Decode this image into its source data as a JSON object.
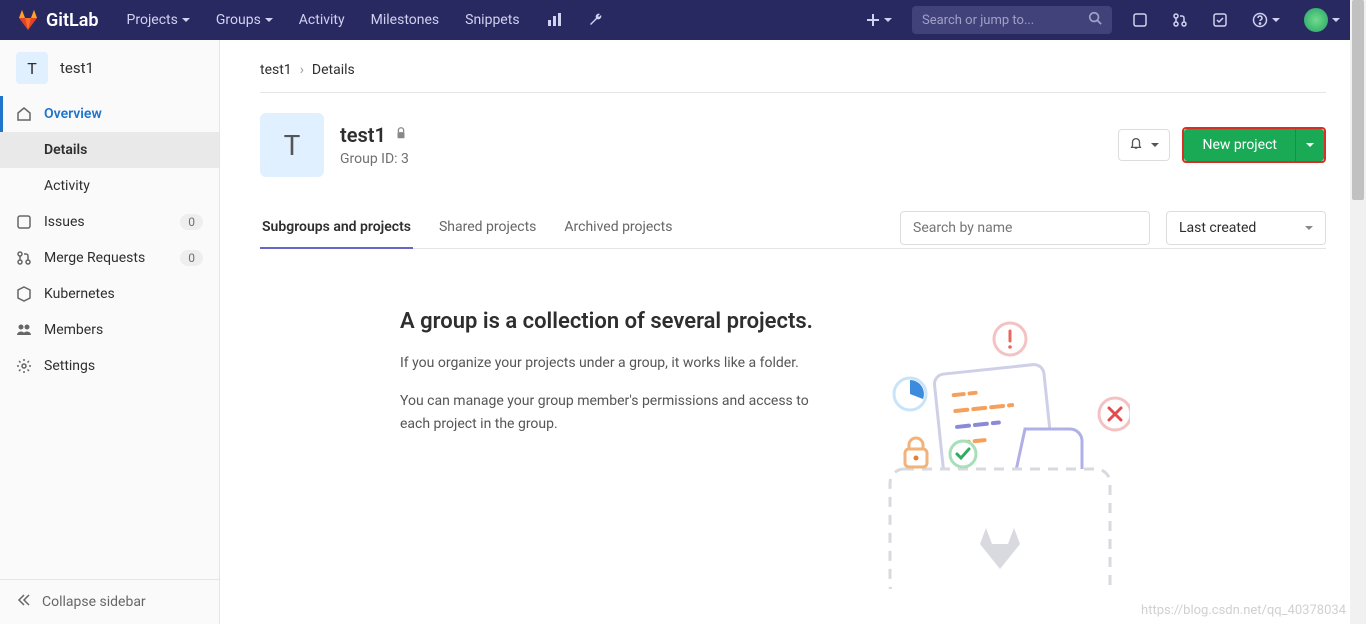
{
  "brand": "GitLab",
  "nav": {
    "links": [
      "Projects",
      "Groups",
      "Activity",
      "Milestones",
      "Snippets"
    ],
    "search_placeholder": "Search or jump to..."
  },
  "context": {
    "avatar_letter": "T",
    "name": "test1"
  },
  "sidebar": {
    "items": [
      {
        "label": "Overview"
      },
      {
        "label": "Details"
      },
      {
        "label": "Activity"
      },
      {
        "label": "Issues",
        "badge": "0"
      },
      {
        "label": "Merge Requests",
        "badge": "0"
      },
      {
        "label": "Kubernetes"
      },
      {
        "label": "Members"
      },
      {
        "label": "Settings"
      }
    ],
    "collapse": "Collapse sidebar"
  },
  "breadcrumb": {
    "root": "test1",
    "current": "Details"
  },
  "group": {
    "avatar_letter": "T",
    "name": "test1",
    "id_label": "Group ID: 3",
    "new_project": "New project"
  },
  "tabs": {
    "items": [
      "Subgroups and projects",
      "Shared projects",
      "Archived projects"
    ],
    "filter_placeholder": "Search by name",
    "sort": "Last created"
  },
  "empty": {
    "heading": "A group is a collection of several projects.",
    "p1": "If you organize your projects under a group, it works like a folder.",
    "p2": "You can manage your group member's permissions and access to each project in the group."
  },
  "watermark": "https://blog.csdn.net/qq_40378034"
}
